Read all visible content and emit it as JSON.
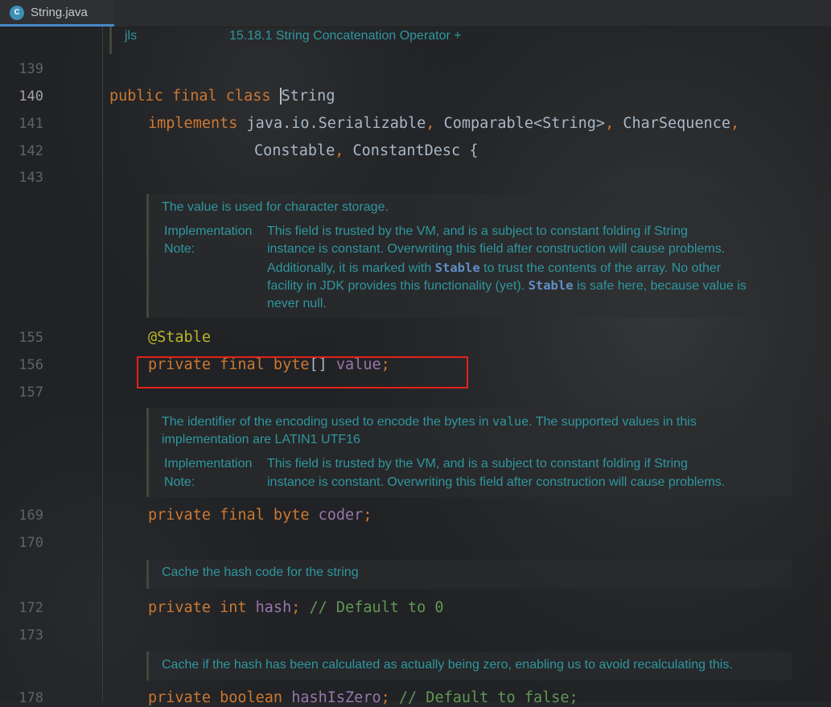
{
  "tab": {
    "filename": "String.java",
    "icon": "java-class-icon"
  },
  "top_doc": {
    "label": "jls",
    "value": "15.18.1 String Concatenation Operator +"
  },
  "line_numbers": {
    "l139": "139",
    "l140": "140",
    "l141": "141",
    "l142": "142",
    "l143": "143",
    "l155": "155",
    "l156": "156",
    "l157": "157",
    "l169": "169",
    "l170": "170",
    "l172": "172",
    "l173": "173",
    "l178": "178"
  },
  "code": {
    "l140": {
      "kw": "public final class ",
      "name": "String"
    },
    "l141": {
      "kw": "implements ",
      "t1": "java.io.Serializable",
      "p1": ", ",
      "t2": "Comparable<String>",
      "p2": ", ",
      "t3": "CharSequence",
      "p3": ","
    },
    "l142": {
      "t1": "Constable",
      "p1": ", ",
      "t2": "ConstantDesc {"
    },
    "l155": {
      "ann": "@Stable"
    },
    "l156": {
      "kw": "private final byte",
      "br": "[] ",
      "fld": "value",
      "semi": ";"
    },
    "l169": {
      "kw": "private final byte ",
      "fld": "coder",
      "semi": ";"
    },
    "l172": {
      "kw": "private int ",
      "fld": "hash",
      "semi": "; ",
      "cmt": "// Default to 0"
    },
    "l178": {
      "kw": "private boolean ",
      "fld": "hashIsZero",
      "semi": "; ",
      "cmt": "// Default to false;"
    }
  },
  "docs": {
    "value": {
      "summary": "The value is used for character storage.",
      "note_label_1": "Implementation",
      "note_label_2": "Note:",
      "note_r1": "This field is trusted by the VM, and is a subject to constant folding if String",
      "note_r2": "instance is constant. Overwriting this field after construction will cause problems.",
      "note_r3a": "Additionally, it is marked with ",
      "note_r3b": "Stable",
      "note_r3c": " to trust the contents of the array. No other",
      "note_r4a": "facility in JDK provides this functionality (yet). ",
      "note_r4b": "Stable",
      "note_r4c": " is safe here, because value is",
      "note_r5": "never null."
    },
    "coder": {
      "s1a": "The identifier of the encoding used to encode the bytes in ",
      "s1b": "value",
      "s1c": ". The supported values in this",
      "s2": "implementation are LATIN1 UTF16",
      "note_label_1": "Implementation",
      "note_label_2": "Note:",
      "note_r1": "This field is trusted by the VM, and is a subject to constant folding if String",
      "note_r2": "instance is constant. Overwriting this field after construction will cause problems."
    },
    "hash": {
      "summary": "Cache the hash code for the string"
    },
    "hashIsZero": {
      "summary": "Cache if the hash has been calculated as actually being zero, enabling us to avoid recalculating this."
    }
  },
  "colors": {
    "highlight_box": "#e2231a",
    "keyword": "#cc7832",
    "field": "#9876aa",
    "annotation": "#bbb529",
    "comment": "#629755",
    "doc_text": "#2f97a0"
  }
}
